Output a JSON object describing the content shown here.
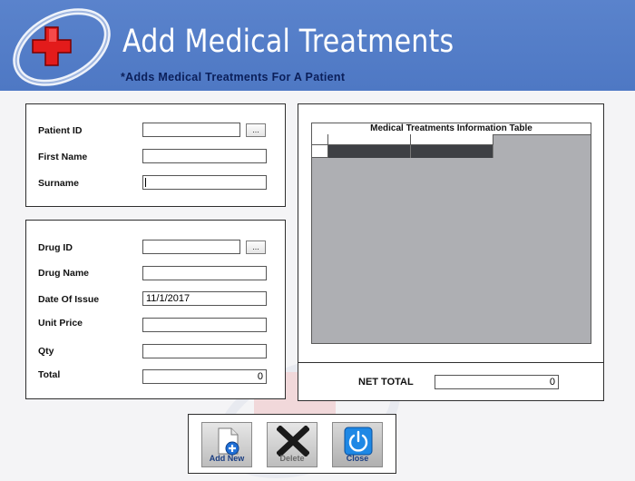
{
  "header": {
    "title": "Add Medical Treatments",
    "subtitle": "*Adds Medical Treatments For A Patient"
  },
  "patient": {
    "patient_id_label": "Patient ID",
    "patient_id_value": "",
    "lookup_label": "...",
    "first_name_label": "First Name",
    "first_name_value": "",
    "surname_label": "Surname",
    "surname_value": ""
  },
  "drug": {
    "drug_id_label": "Drug ID",
    "drug_id_value": "",
    "lookup_label": "...",
    "drug_name_label": "Drug Name",
    "drug_name_value": "",
    "date_of_issue_label": "Date Of Issue",
    "date_of_issue_value": "11/1/2017",
    "unit_price_label": "Unit Price",
    "unit_price_value": "",
    "qty_label": "Qty",
    "qty_value": "",
    "total_label": "Total",
    "total_value": "0"
  },
  "table": {
    "caption": "Medical Treatments Information Table",
    "net_total_label": "NET TOTAL",
    "net_total_value": "0"
  },
  "toolbar": {
    "add_new_label": "Add New",
    "delete_label": "Delete",
    "close_label": "Close"
  },
  "colors": {
    "header_blue": "#5a83cc",
    "subtitle_navy": "#0b1f5a",
    "logo_red": "#e31b1b",
    "grid_selected_row": "#3e4044"
  },
  "icons": [
    "medical-cross-logo-icon",
    "add-document-icon",
    "delete-x-icon",
    "power-icon"
  ]
}
